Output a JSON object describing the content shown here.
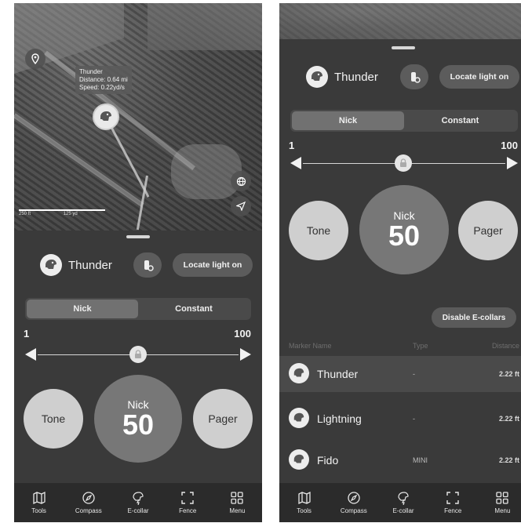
{
  "map": {
    "tooltip": {
      "name": "Thunder",
      "distance": "Distance: 0.64 mi",
      "speed": "Speed: 0.22yd/s"
    },
    "scale": {
      "left": "250 ft",
      "right": "125 yd"
    }
  },
  "left": {
    "dog_name": "Thunder",
    "locate_label": "Locate light on",
    "segments": [
      "Nick",
      "Constant"
    ],
    "range_min": "1",
    "range_max": "100",
    "tone_label": "Tone",
    "pager_label": "Pager",
    "nick_label": "Nick",
    "nick_value": "50"
  },
  "right": {
    "dog_name": "Thunder",
    "locate_label": "Locate light on",
    "segments": [
      "Nick",
      "Constant"
    ],
    "range_min": "1",
    "range_max": "100",
    "tone_label": "Tone",
    "pager_label": "Pager",
    "nick_label": "Nick",
    "nick_value": "50",
    "disable_label": "Disable E-collars",
    "columns": [
      "Marker Name",
      "Type",
      "Distance"
    ],
    "markers": [
      {
        "name": "Thunder",
        "type": "-",
        "distance": "2.22 ft"
      },
      {
        "name": "Lightning",
        "type": "-",
        "distance": "2.22 ft"
      },
      {
        "name": "Fido",
        "type": "MINI",
        "distance": "2.22 ft"
      }
    ]
  },
  "tabs": [
    "Tools",
    "Compass",
    "E-collar",
    "Fence",
    "Menu"
  ],
  "icons": [
    "map-icon",
    "compass-icon",
    "ecollar-icon",
    "fence-icon",
    "grid-icon",
    "dog-icon",
    "collar-device-icon",
    "lock-icon",
    "location-pin-icon",
    "navigate-icon",
    "globe-icon"
  ]
}
